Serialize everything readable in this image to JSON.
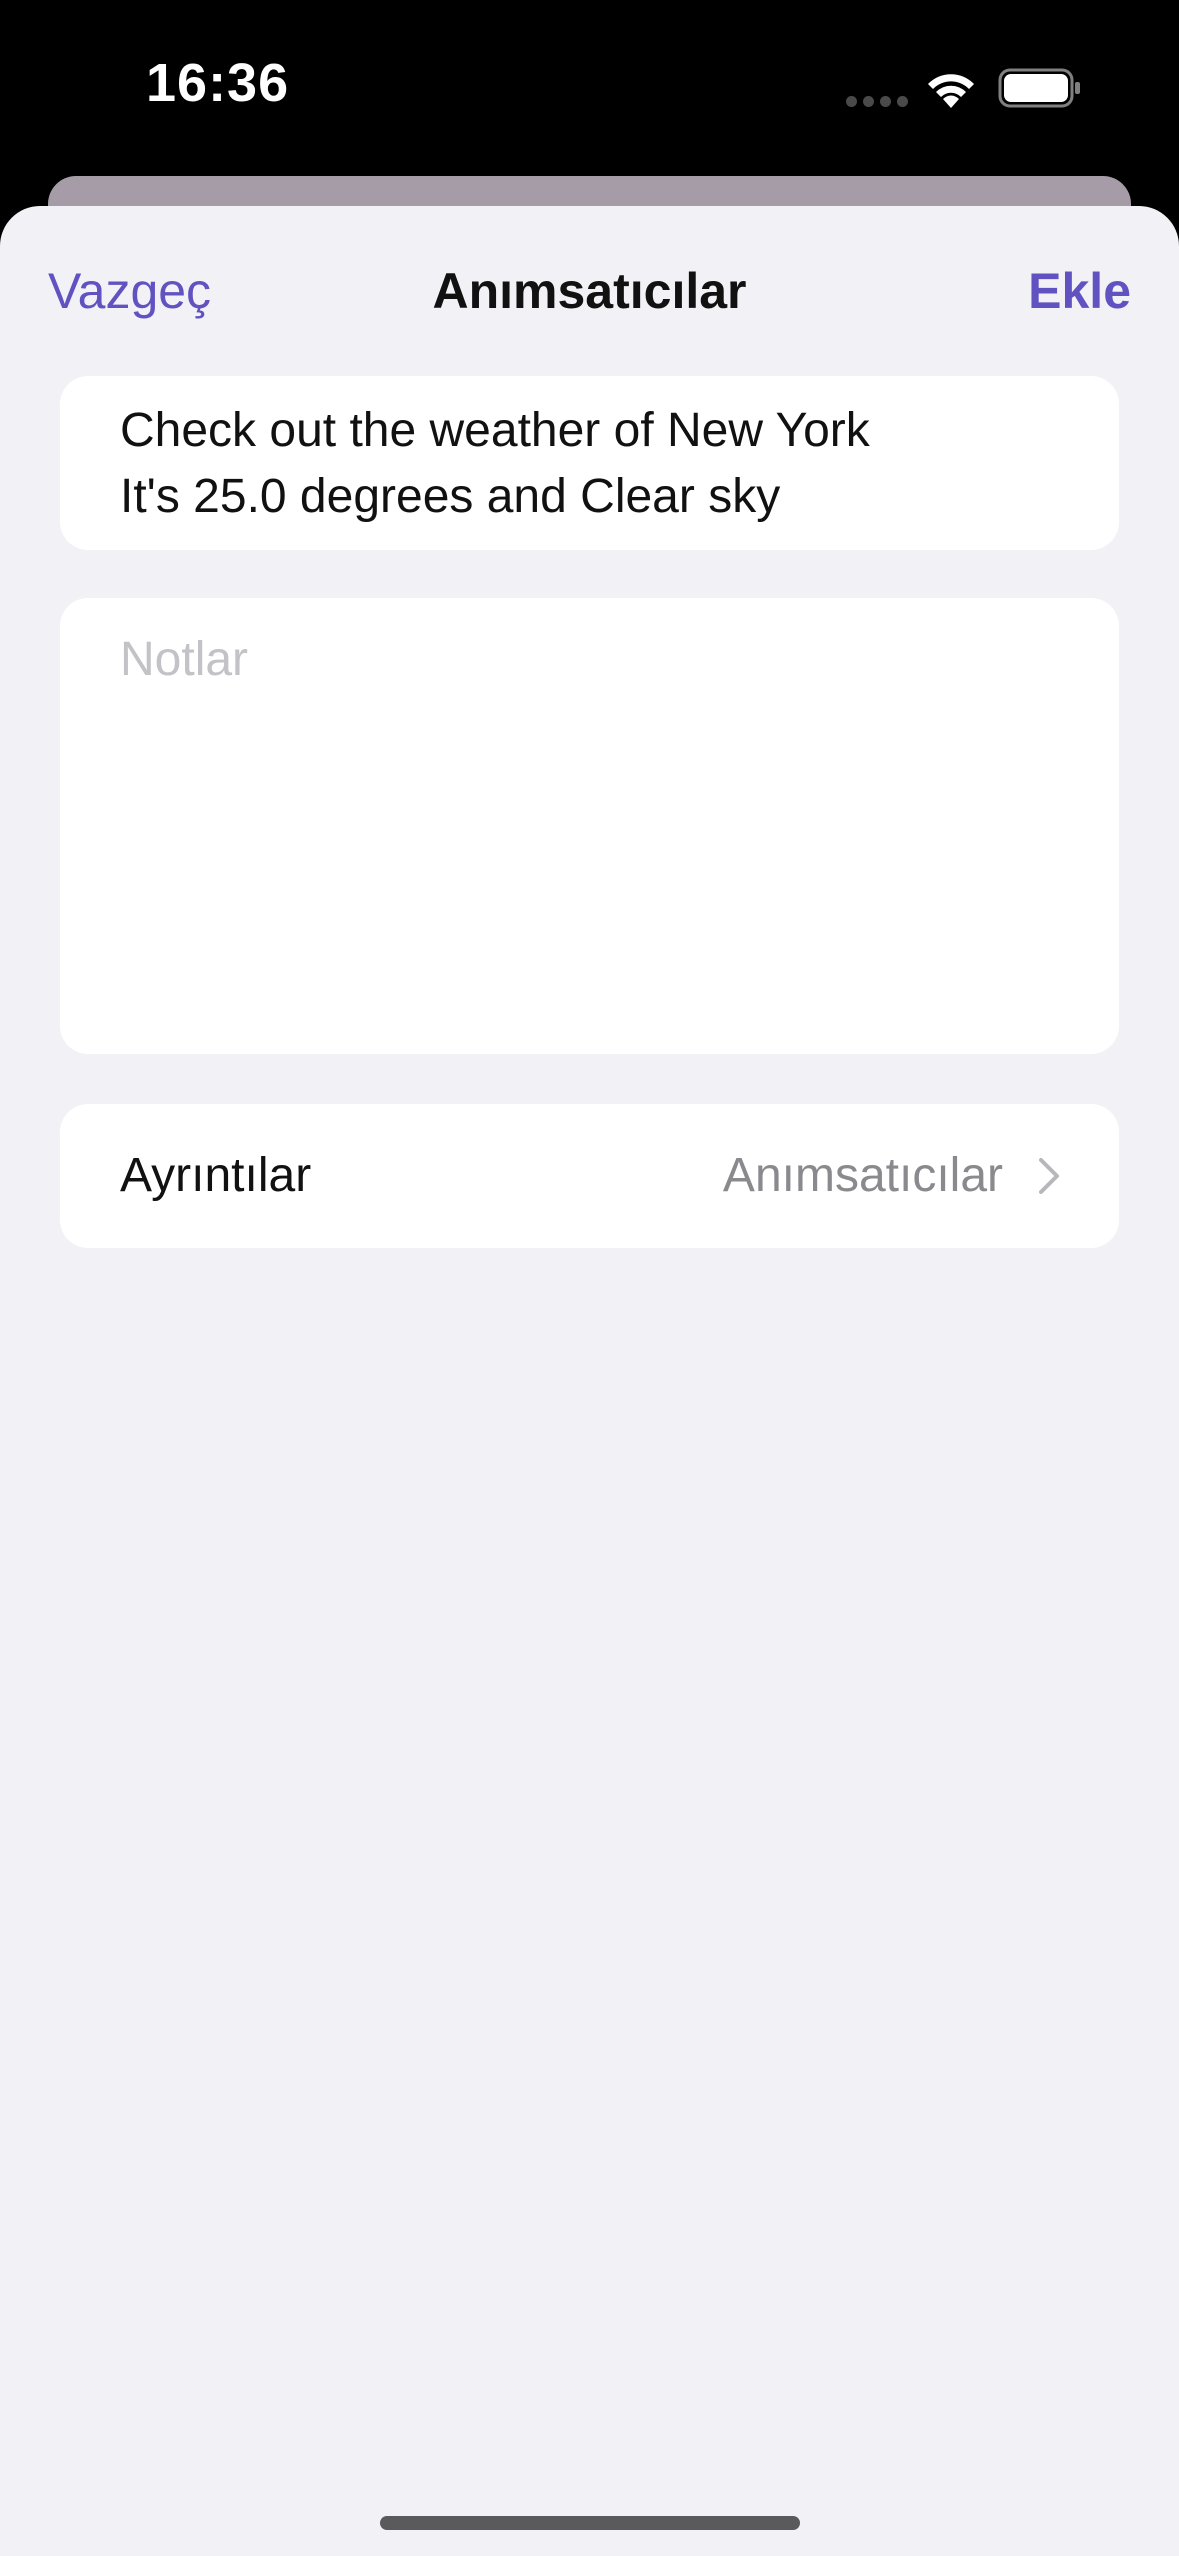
{
  "status_bar": {
    "time": "16:36",
    "icons": [
      "cellular-dots-icon",
      "wifi-icon",
      "battery-icon"
    ]
  },
  "nav": {
    "cancel_label": "Vazgeç",
    "title": "Anımsatıcılar",
    "add_label": "Ekle"
  },
  "reminder": {
    "title_text": "Check out the weather of New York\nIt's 25.0 degrees and Clear sky"
  },
  "notes": {
    "placeholder": "Notlar",
    "value": ""
  },
  "details": {
    "label": "Ayrıntılar",
    "value": "Anımsatıcılar",
    "icon": "chevron-right-icon"
  },
  "colors": {
    "accent": "#6152c1",
    "sheet_background": "#f2f1f6",
    "card_background": "#ffffff",
    "secondary_text": "#8a8a8e",
    "placeholder_text": "#c3c3c7"
  }
}
